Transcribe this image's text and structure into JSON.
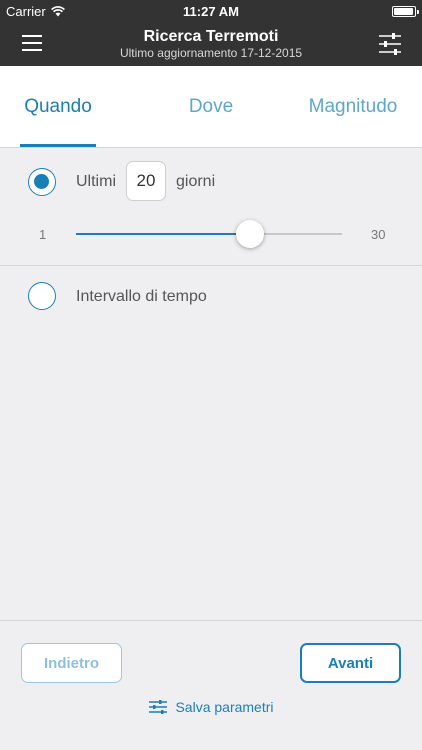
{
  "status_bar": {
    "carrier": "Carrier",
    "time": "11:27 AM"
  },
  "nav": {
    "title": "Ricerca Terremoti",
    "subtitle": "Ultimo aggiornamento 17-12-2015",
    "left_icon": "hamburger-menu-icon",
    "right_icon": "sliders-filter-icon"
  },
  "tabs": [
    {
      "label": "Quando",
      "active": true
    },
    {
      "label": "Dove",
      "active": false
    },
    {
      "label": "Magnitudo",
      "active": false
    }
  ],
  "options": {
    "last_days": {
      "selected": true,
      "prefix": "Ultimi",
      "value": "20",
      "suffix": "giorni",
      "slider": {
        "min": "1",
        "max": "30",
        "value": 20
      }
    },
    "interval": {
      "selected": false,
      "label": "Intervallo di tempo"
    }
  },
  "footer": {
    "back_label": "Indietro",
    "next_label": "Avanti",
    "save_label": "Salva parametri",
    "save_icon": "sliders-icon"
  },
  "colors": {
    "accent": "#1a7fb5",
    "accent_light": "#5ba7cf",
    "navbar": "#333333",
    "background": "#efeff1"
  }
}
